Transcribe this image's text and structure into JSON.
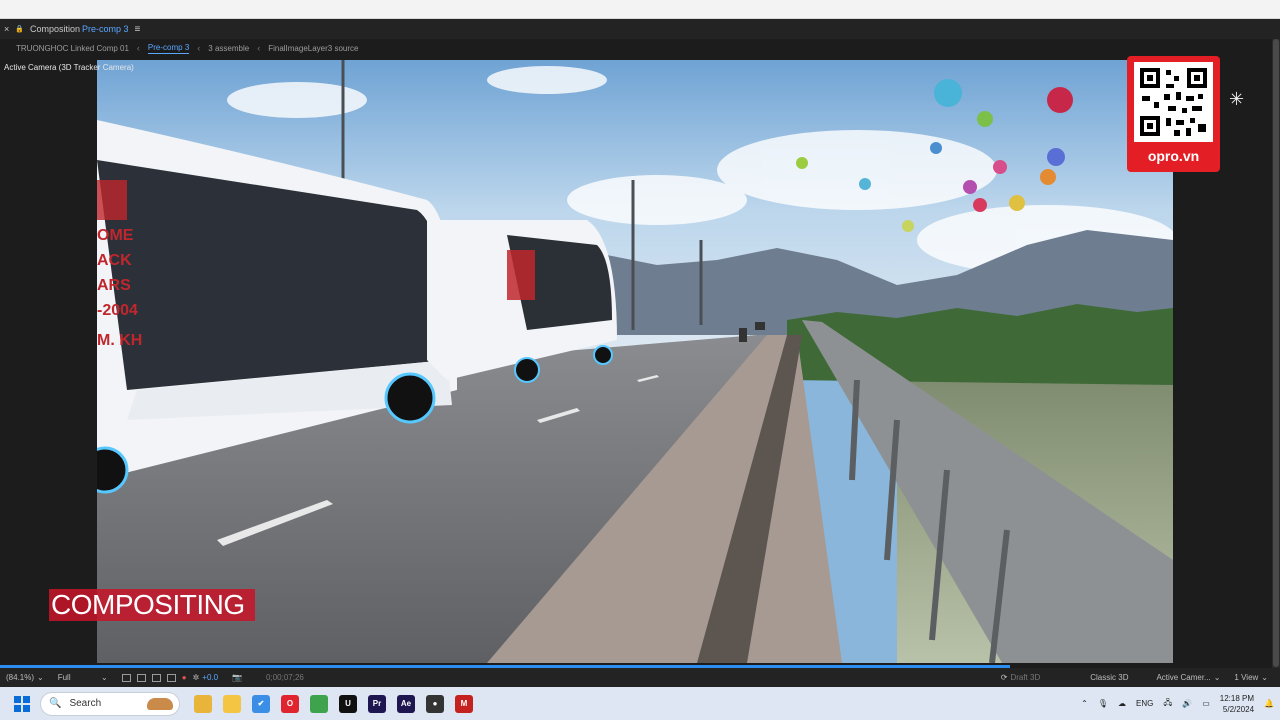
{
  "panel": {
    "close_glyph": "×",
    "lock_glyph": "🔒",
    "title_prefix": "Composition",
    "comp_name": "Pre-comp 3",
    "menu_glyph": "≡"
  },
  "breadcrumb": {
    "items": [
      "TRUONGHOC Linked Comp 01",
      "Pre-comp 3",
      "3 assemble",
      "FinalImageLayer3 source"
    ],
    "active_index": 1
  },
  "viewer": {
    "camera_label": "Active Camera (3D Tracker Camera)"
  },
  "overlay": {
    "qr_label": "opro.vn",
    "caption": "COMPOSITING"
  },
  "viewer_bar": {
    "zoom": "(84.1%)",
    "resolution": "Full",
    "exposure": "+0.0",
    "timecode": "0;00;07;26",
    "draft_3d": "Draft 3D",
    "renderer": "Classic 3D",
    "camera": "Active Camer...",
    "view": "1 View"
  },
  "taskbar": {
    "search_placeholder": "Search",
    "apps": [
      {
        "name": "chrome-icon",
        "text": "",
        "color": "#e8b43a"
      },
      {
        "name": "file-explorer-icon",
        "text": "",
        "color": "#f4c542"
      },
      {
        "name": "check-app-icon",
        "text": "✔",
        "color": "#3a8ee6"
      },
      {
        "name": "opera-icon",
        "text": "O",
        "color": "#e0242f"
      },
      {
        "name": "colorful-app-icon",
        "text": "",
        "color": "#3fa34d"
      },
      {
        "name": "unreal-icon",
        "text": "U",
        "color": "#111111"
      },
      {
        "name": "premiere-icon",
        "text": "Pr",
        "color": "#1e1650"
      },
      {
        "name": "after-effects-icon",
        "text": "Ae",
        "color": "#1e1650"
      },
      {
        "name": "obs-icon",
        "text": "●",
        "color": "#333333"
      },
      {
        "name": "gmail-icon",
        "text": "M",
        "color": "#c5221f"
      }
    ],
    "language": "ENG",
    "time": "12:18 PM",
    "date": "5/2/2024"
  },
  "colors": {
    "accent": "#5aa7ff",
    "progress": "#2d8cf0",
    "badge": "#e31e24"
  }
}
